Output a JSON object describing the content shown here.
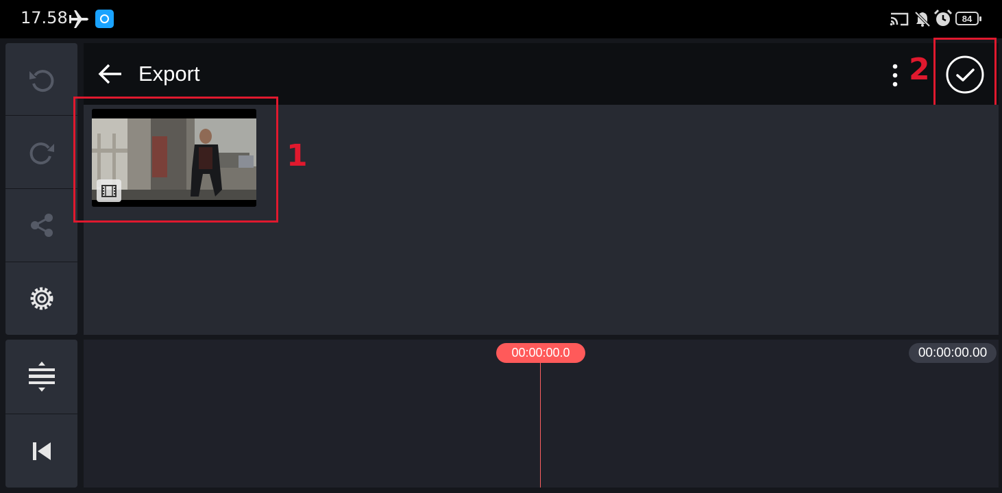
{
  "status_bar": {
    "time": "17.58",
    "battery": "84",
    "icons": [
      "airplane-icon",
      "screen-recorder-icon",
      "cast-icon",
      "mute-icon",
      "alarm-icon",
      "battery-icon"
    ]
  },
  "left_rail": {
    "items": [
      "undo-icon",
      "redo-icon",
      "share-icon",
      "settings-icon"
    ],
    "bottom_items": [
      "fit-timeline-icon",
      "skip-to-start-icon"
    ]
  },
  "header": {
    "title": "Export",
    "icons": [
      "back-arrow-icon",
      "more-options-icon",
      "confirm-check-icon"
    ]
  },
  "annotations": {
    "label_1": "1",
    "label_2": "2",
    "color": "#e0192e"
  },
  "media": {
    "items": [
      {
        "type": "video",
        "icon": "film-icon"
      }
    ]
  },
  "timeline": {
    "playhead_time": "00:00:00.0",
    "duration": "00:00:00.00",
    "playhead_color": "#ff5a5a"
  }
}
